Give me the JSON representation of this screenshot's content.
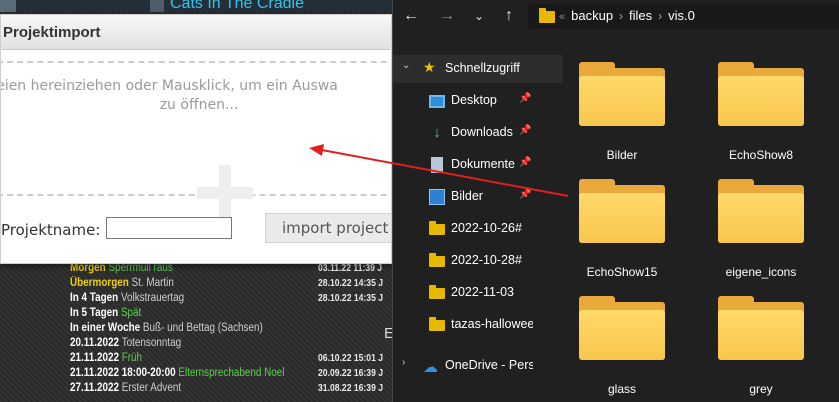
{
  "background": {
    "song_title": "Cats In The Cradle",
    "events": [
      {
        "lead": "Morgen",
        "text": "Morgen Sperrmüll raus",
        "style": "yellow-green",
        "date": "03.11.22 11:39 J"
      },
      {
        "lead": "Übermorgen",
        "text": "St. Martin",
        "style": "yellow-grey",
        "date": "28.10.22 14:35 J"
      },
      {
        "lead": "In 4 Tagen",
        "text": "Volkstrauertag",
        "style": "white-grey",
        "date": "28.10.22 14:35 J"
      },
      {
        "lead": "In 5 Tagen",
        "text": "Spät",
        "style": "white-green",
        "date": ""
      },
      {
        "lead": "In einer Woche",
        "text": "Buß- und Bettag (Sachsen)",
        "style": "white-grey",
        "date": ""
      },
      {
        "lead": "20.11.2022",
        "text": "Totensonntag",
        "style": "white-grey",
        "date": ""
      },
      {
        "lead": "21.11.2022",
        "text": "Früh",
        "style": "white-green",
        "date": "06.10.22 15:01 J"
      },
      {
        "lead": "21.11.2022 18:00-20:00",
        "text": "Elternsprechabend Noel",
        "style": "white-green",
        "date": "20.09.22 16:39 J"
      },
      {
        "lead": "27.11.2022",
        "text": "Erster Advent",
        "style": "white-grey",
        "date": "31.08.22 16:39 J"
      }
    ],
    "side_letter": "E"
  },
  "dialog": {
    "title": "Projektimport",
    "drop_line1": "ateien hereinziehen oder Mausklick, um ein Auswa",
    "drop_line2": "zu öffnen...",
    "project_label": "Projektname:",
    "project_value": "",
    "import_button": "import project"
  },
  "explorer": {
    "breadcrumb": [
      "backup",
      "files",
      "vis.0"
    ],
    "nav": [
      {
        "label": "Schnellzugriff",
        "icon": "star-icon",
        "pinned": false
      },
      {
        "label": "Desktop",
        "icon": "desktop-icon",
        "pinned": true
      },
      {
        "label": "Downloads",
        "icon": "download-icon",
        "pinned": true
      },
      {
        "label": "Dokumente",
        "icon": "document-icon",
        "pinned": true
      },
      {
        "label": "Bilder",
        "icon": "pictures-icon",
        "pinned": true
      },
      {
        "label": "2022-10-26#",
        "icon": "folder-icon",
        "pinned": false
      },
      {
        "label": "2022-10-28#",
        "icon": "folder-icon",
        "pinned": false
      },
      {
        "label": "2022-11-03",
        "icon": "folder-icon",
        "pinned": false
      },
      {
        "label": "tazas-halloween",
        "icon": "folder-icon",
        "pinned": false
      },
      {
        "label": "OneDrive - Perso",
        "icon": "cloud-icon",
        "pinned": false
      }
    ],
    "folders": [
      "Bilder",
      "EchoShow8",
      "EchoShow15",
      "eigene_icons",
      "glass",
      "grey"
    ]
  },
  "colors": {
    "folder_yellow": "#f8c64c",
    "explorer_bg": "#202020",
    "arrow_red": "#e0201e",
    "event_yellow": "#f0d000",
    "event_green": "#59d34a",
    "song_cyan": "#33c4e8"
  }
}
